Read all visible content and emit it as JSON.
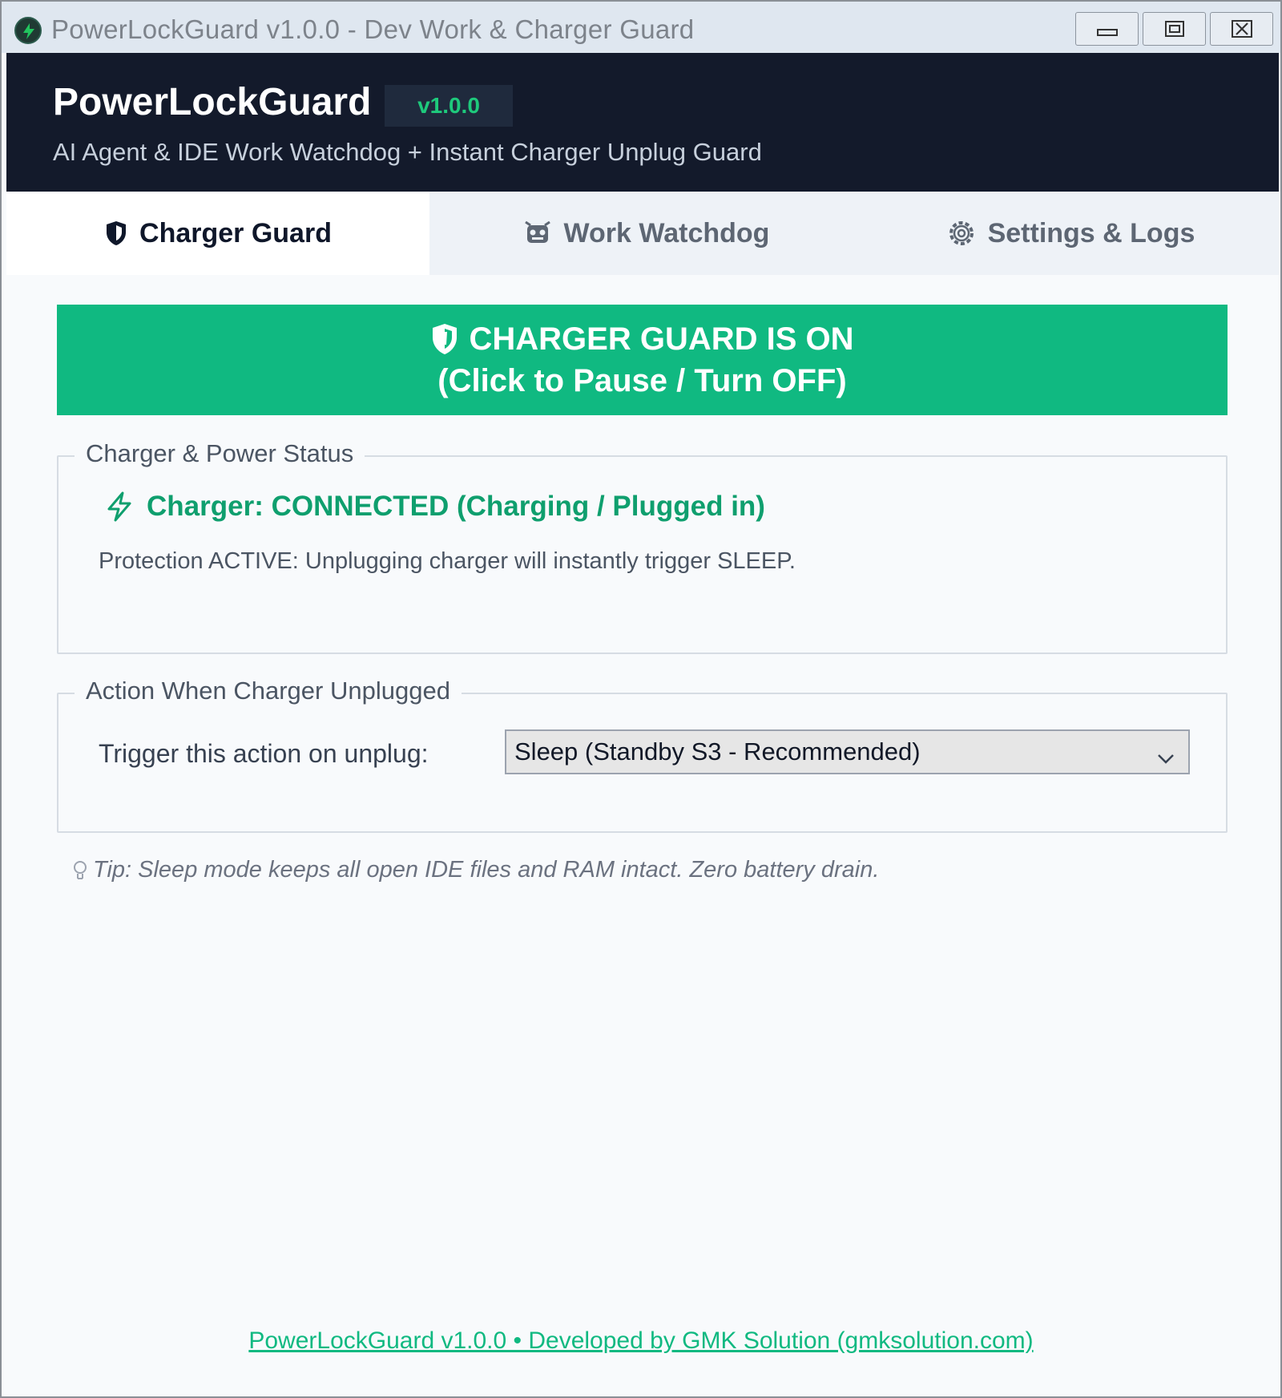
{
  "window": {
    "title": "PowerLockGuard v1.0.0 - Dev Work & Charger Guard",
    "icon": "power-bolt-icon",
    "controls": [
      "minimize-icon",
      "maximize-icon",
      "close-icon"
    ]
  },
  "header": {
    "brand": "PowerLockGuard",
    "version": "v1.0.0",
    "subtitle": "AI Agent & IDE Work Watchdog + Instant Charger Unplug Guard"
  },
  "tabs": [
    {
      "label": "Charger Guard",
      "icon": "shield-icon",
      "active": true
    },
    {
      "label": "Work Watchdog",
      "icon": "robot-icon",
      "active": false
    },
    {
      "label": "Settings & Logs",
      "icon": "gear-icon",
      "active": false
    }
  ],
  "guard": {
    "line1": "CHARGER GUARD IS ON",
    "line2": "(Click to Pause / Turn OFF)",
    "color": "#10b981"
  },
  "status_group": {
    "title": "Charger & Power Status",
    "charger_status": "Charger: CONNECTED (Charging / Plugged in)",
    "protection": "Protection ACTIVE: Unplugging charger will instantly trigger SLEEP."
  },
  "action_group": {
    "title": "Action When Charger Unplugged",
    "trigger_label": "Trigger this action on unplug:",
    "selected_action": "Sleep (Standby S3 - Recommended)"
  },
  "tip": "Tip: Sleep mode keeps all open IDE files and RAM intact. Zero battery drain.",
  "footer": "PowerLockGuard v1.0.0 • Developed by GMK Solution (gmksolution.com)",
  "colors": {
    "accent": "#10b981",
    "header_bg": "#131a2b",
    "status_text": "#0f9f6e"
  }
}
